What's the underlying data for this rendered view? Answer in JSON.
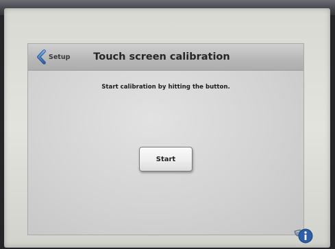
{
  "header": {
    "back_label": "Setup",
    "back_icon": "chevron-left-icon",
    "title": "Touch screen calibration"
  },
  "main": {
    "instruction": "Start calibration by hitting the button.",
    "start_label": "Start"
  },
  "corner": {
    "icon": "info-tools-icon"
  },
  "colors": {
    "accent_blue": "#3a6fb5",
    "header_gray": "#b9b9b9",
    "screen_gray": "#d3d3d3"
  }
}
